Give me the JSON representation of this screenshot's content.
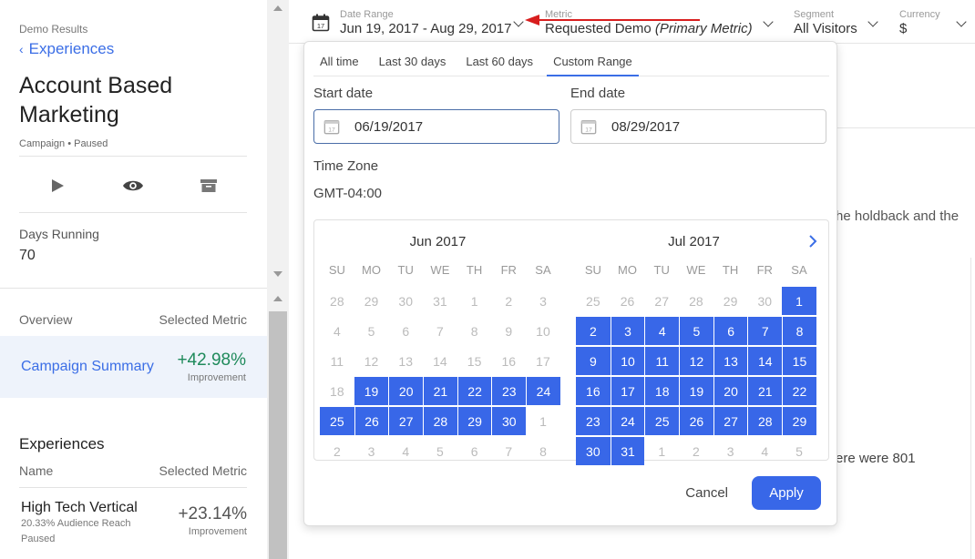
{
  "sidebar": {
    "breadcrumb": "Demo Results",
    "back_label": "Experiences",
    "title": "Account Based Marketing",
    "meta": "Campaign • Paused",
    "days_label": "Days Running",
    "days_value": "70",
    "overview_label": "Overview",
    "selected_metric_label": "Selected Metric",
    "summary": {
      "name": "Campaign Summary",
      "value": "+42.98%",
      "value_label": "Improvement"
    },
    "experiences_title": "Experiences",
    "name_col": "Name",
    "metric_col": "Selected Metric",
    "experience_row": {
      "name": "High Tech Vertical",
      "reach": "20.33% Audience Reach",
      "status": "Paused",
      "value": "+23.14%",
      "value_label": "Improvement"
    }
  },
  "topbar": {
    "date_range": {
      "label": "Date Range",
      "value": "Jun 19, 2017 - Aug 29, 2017"
    },
    "metric": {
      "label": "Metric",
      "value": "Requested Demo",
      "suffix": "(Primary Metric)"
    },
    "segment": {
      "label": "Segment",
      "value": "All Visitors"
    },
    "currency": {
      "label": "Currency",
      "value": "$"
    }
  },
  "background": {
    "paren": ")",
    "text1": "he holdback and the",
    "text2": "ere were 801"
  },
  "picker": {
    "tabs": [
      "All time",
      "Last 30 days",
      "Last 60 days",
      "Custom Range"
    ],
    "active_tab": 3,
    "start_label": "Start date",
    "start_value": "06/19/2017",
    "end_label": "End date",
    "end_value": "08/29/2017",
    "tz_label": "Time Zone",
    "tz_value": "GMT-04:00",
    "days_of_week": [
      "SU",
      "MO",
      "TU",
      "WE",
      "TH",
      "FR",
      "SA"
    ],
    "months": [
      {
        "title": "Jun 2017",
        "weeks": [
          [
            "28",
            "29",
            "30",
            "31",
            "1",
            "2",
            "3"
          ],
          [
            "4",
            "5",
            "6",
            "7",
            "8",
            "9",
            "10"
          ],
          [
            "11",
            "12",
            "13",
            "14",
            "15",
            "16",
            "17"
          ],
          [
            "18",
            "19",
            "20",
            "21",
            "22",
            "23",
            "24"
          ],
          [
            "25",
            "26",
            "27",
            "28",
            "29",
            "30",
            "1"
          ],
          [
            "2",
            "3",
            "4",
            "5",
            "6",
            "7",
            "8"
          ]
        ],
        "selected": [
          [
            3,
            1
          ],
          [
            3,
            2
          ],
          [
            3,
            3
          ],
          [
            3,
            4
          ],
          [
            3,
            5
          ],
          [
            3,
            6
          ],
          [
            4,
            0
          ],
          [
            4,
            1
          ],
          [
            4,
            2
          ],
          [
            4,
            3
          ],
          [
            4,
            4
          ],
          [
            4,
            5
          ]
        ]
      },
      {
        "title": "Jul 2017",
        "weeks": [
          [
            "25",
            "26",
            "27",
            "28",
            "29",
            "30",
            "1"
          ],
          [
            "2",
            "3",
            "4",
            "5",
            "6",
            "7",
            "8"
          ],
          [
            "9",
            "10",
            "11",
            "12",
            "13",
            "14",
            "15"
          ],
          [
            "16",
            "17",
            "18",
            "19",
            "20",
            "21",
            "22"
          ],
          [
            "23",
            "24",
            "25",
            "26",
            "27",
            "28",
            "29"
          ],
          [
            "30",
            "31",
            "1",
            "2",
            "3",
            "4",
            "5"
          ]
        ],
        "selected": [
          [
            0,
            6
          ],
          [
            1,
            0
          ],
          [
            1,
            1
          ],
          [
            1,
            2
          ],
          [
            1,
            3
          ],
          [
            1,
            4
          ],
          [
            1,
            5
          ],
          [
            1,
            6
          ],
          [
            2,
            0
          ],
          [
            2,
            1
          ],
          [
            2,
            2
          ],
          [
            2,
            3
          ],
          [
            2,
            4
          ],
          [
            2,
            5
          ],
          [
            2,
            6
          ],
          [
            3,
            0
          ],
          [
            3,
            1
          ],
          [
            3,
            2
          ],
          [
            3,
            3
          ],
          [
            3,
            4
          ],
          [
            3,
            5
          ],
          [
            3,
            6
          ],
          [
            4,
            0
          ],
          [
            4,
            1
          ],
          [
            4,
            2
          ],
          [
            4,
            3
          ],
          [
            4,
            4
          ],
          [
            4,
            5
          ],
          [
            4,
            6
          ],
          [
            5,
            0
          ],
          [
            5,
            1
          ]
        ]
      }
    ],
    "cancel_label": "Cancel",
    "apply_label": "Apply"
  },
  "colors": {
    "accent": "#3867e8",
    "link": "#3b6ee6",
    "positive": "#1f8a5b",
    "annotation_arrow": "#d81e1e"
  },
  "icons": {
    "play": "play-icon",
    "preview": "eye-icon",
    "archive": "archive-icon",
    "calendar": "calendar-icon",
    "next": "chevron-right-icon",
    "back": "chevron-left-icon"
  }
}
